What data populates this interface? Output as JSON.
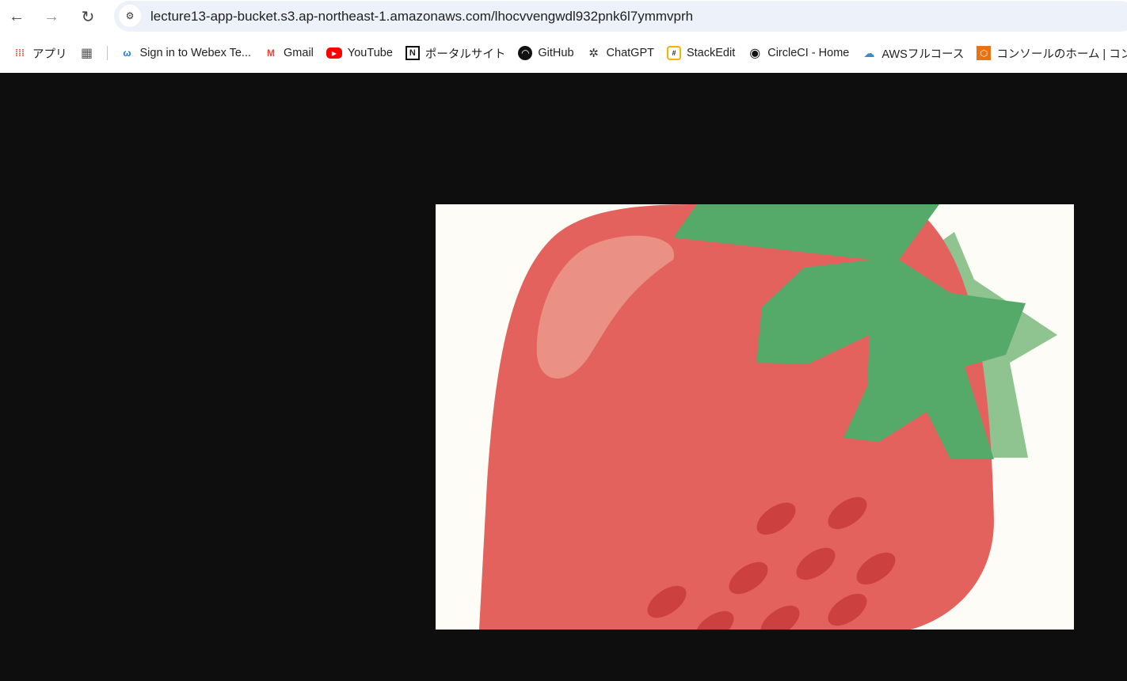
{
  "browser": {
    "url": "lecture13-app-bucket.s3.ap-northeast-1.amazonaws.com/lhocvvengwdl932pnk6l7ymmvprh",
    "bookmarks": [
      {
        "label": "アプリ",
        "icon": "apps-grid-icon"
      },
      {
        "label": "",
        "icon": "tab-groups-icon"
      },
      {
        "label": "Sign in to Webex Te...",
        "icon": "webex-icon"
      },
      {
        "label": "Gmail",
        "icon": "gmail-icon"
      },
      {
        "label": "YouTube",
        "icon": "youtube-icon"
      },
      {
        "label": "ポータルサイト",
        "icon": "notion-icon"
      },
      {
        "label": "GitHub",
        "icon": "github-icon"
      },
      {
        "label": "ChatGPT",
        "icon": "chatgpt-icon"
      },
      {
        "label": "StackEdit",
        "icon": "stackedit-icon"
      },
      {
        "label": "CircleCI - Home",
        "icon": "circleci-icon"
      },
      {
        "label": "AWSフルコース",
        "icon": "aws-course-icon"
      },
      {
        "label": "コンソールのホーム | コン...",
        "icon": "aws-console-icon"
      }
    ]
  },
  "image": {
    "subject": "strawberry-illustration"
  },
  "colors": {
    "body": "#e4625e",
    "leaf": "#55aa6a",
    "leaf_light": "#8fc38f",
    "seed": "#cd4040",
    "bg": "#fdfcf7",
    "highlight": "#ea9085"
  }
}
